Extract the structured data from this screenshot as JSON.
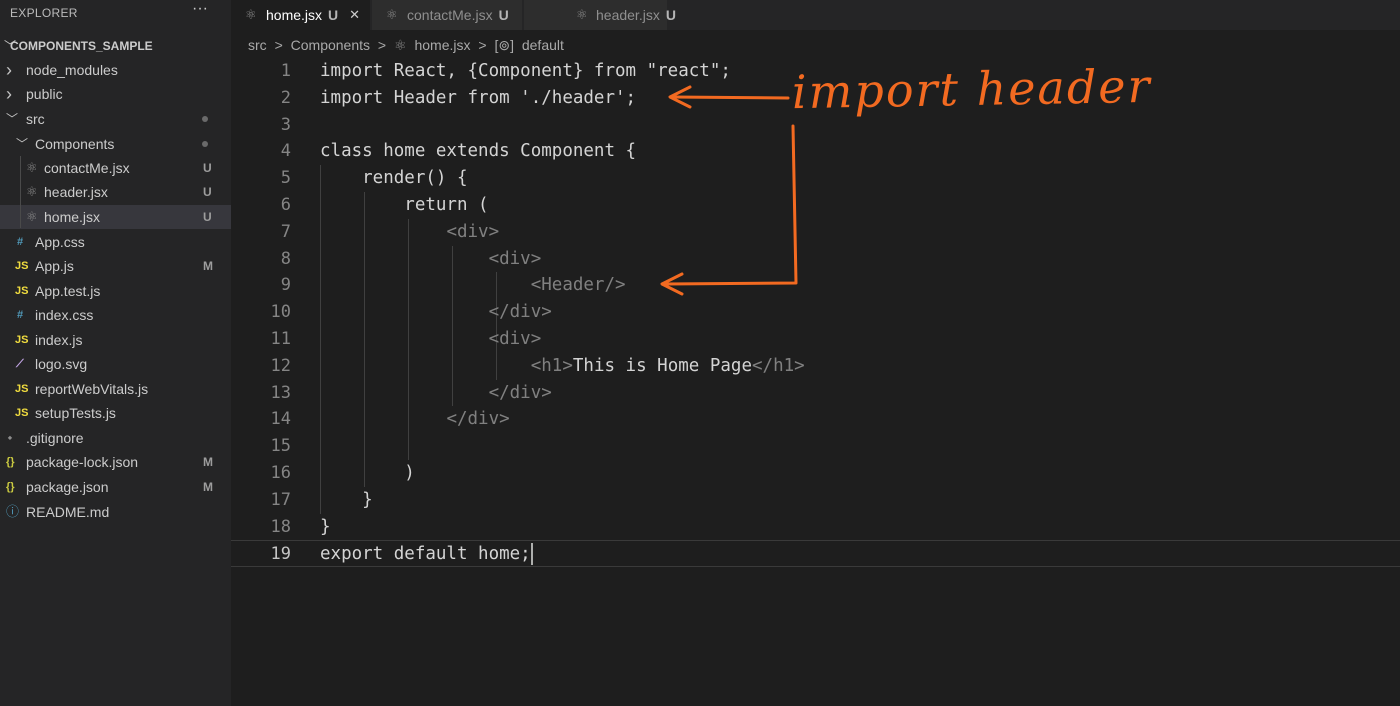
{
  "explorer": {
    "title": "EXPLORER",
    "more_label": "···",
    "project": "COMPONENTS_SAMPLE",
    "items": [
      {
        "label": "node_modules",
        "icon": "chevron-right-icon",
        "kind": "folder"
      },
      {
        "label": "public",
        "icon": "chevron-right-icon",
        "kind": "folder"
      },
      {
        "label": "src",
        "icon": "chevron-down-icon",
        "kind": "folder"
      },
      {
        "label": "Components",
        "icon": "chevron-down-icon",
        "kind": "folder"
      },
      {
        "label": "contactMe.jsx",
        "icon": "react-icon",
        "badge": "U"
      },
      {
        "label": "header.jsx",
        "icon": "react-icon",
        "badge": "U"
      },
      {
        "label": "home.jsx",
        "icon": "react-icon",
        "badge": "U"
      },
      {
        "label": "App.css",
        "icon": "css-icon",
        "icon_text": "#"
      },
      {
        "label": "App.js",
        "icon": "js-icon",
        "icon_text": "JS",
        "badge": "M"
      },
      {
        "label": "App.test.js",
        "icon": "js-icon",
        "icon_text": "JS"
      },
      {
        "label": "index.css",
        "icon": "css-icon",
        "icon_text": "#"
      },
      {
        "label": "index.js",
        "icon": "js-icon",
        "icon_text": "JS"
      },
      {
        "label": "logo.svg",
        "icon": "svg-icon"
      },
      {
        "label": "reportWebVitals.js",
        "icon": "js-icon",
        "icon_text": "JS"
      },
      {
        "label": "setupTests.js",
        "icon": "js-icon",
        "icon_text": "JS"
      },
      {
        "label": ".gitignore",
        "icon": "git-icon"
      },
      {
        "label": "package-lock.json",
        "icon": "json-icon",
        "icon_text": "{}",
        "badge": "M"
      },
      {
        "label": "package.json",
        "icon": "json-icon",
        "icon_text": "{}",
        "badge": "M"
      },
      {
        "label": "README.md",
        "icon": "info-icon"
      }
    ]
  },
  "tabs": [
    {
      "label": "home.jsx",
      "badge": "U",
      "active": true,
      "close": "✕"
    },
    {
      "label": "contactMe.jsx",
      "badge": "U",
      "active": false
    },
    {
      "label": "header.jsx",
      "badge": "U",
      "active": false
    }
  ],
  "breadcrumb": {
    "part1": "src",
    "part2": "Components",
    "part3": "home.jsx",
    "part4": "default",
    "separator": ">"
  },
  "code": {
    "line_numbers": [
      "1",
      "2",
      "3",
      "4",
      "5",
      "6",
      "7",
      "8",
      "9",
      "10",
      "11",
      "12",
      "13",
      "14",
      "15",
      "16",
      "17",
      "18",
      "19"
    ],
    "lines": [
      "import React, {Component} from \"react\";",
      "import Header from './header';",
      "",
      "class home extends Component {",
      "    render() {",
      "        return (",
      "            <div>",
      "                <div>",
      "                    <Header/>",
      "                </div>",
      "                <div>",
      "                    <h1>This is Home Page</h1>",
      "                </div>",
      "            </div>",
      "",
      "        )",
      "    }",
      "}",
      "export default home;"
    ],
    "current_line": 19
  },
  "annotation": {
    "text": "import header",
    "color": "#f26a21"
  },
  "colors": {
    "editor_bg": "#1e1e1e",
    "sidebar_bg": "#252526",
    "untracked_badge": "#73c991",
    "modified_badge": "#e2c08d",
    "js_icon": "#f1dd3f",
    "css_icon": "#519aba",
    "json_icon": "#cbcb41",
    "react_icon": "#8c8c8c"
  }
}
